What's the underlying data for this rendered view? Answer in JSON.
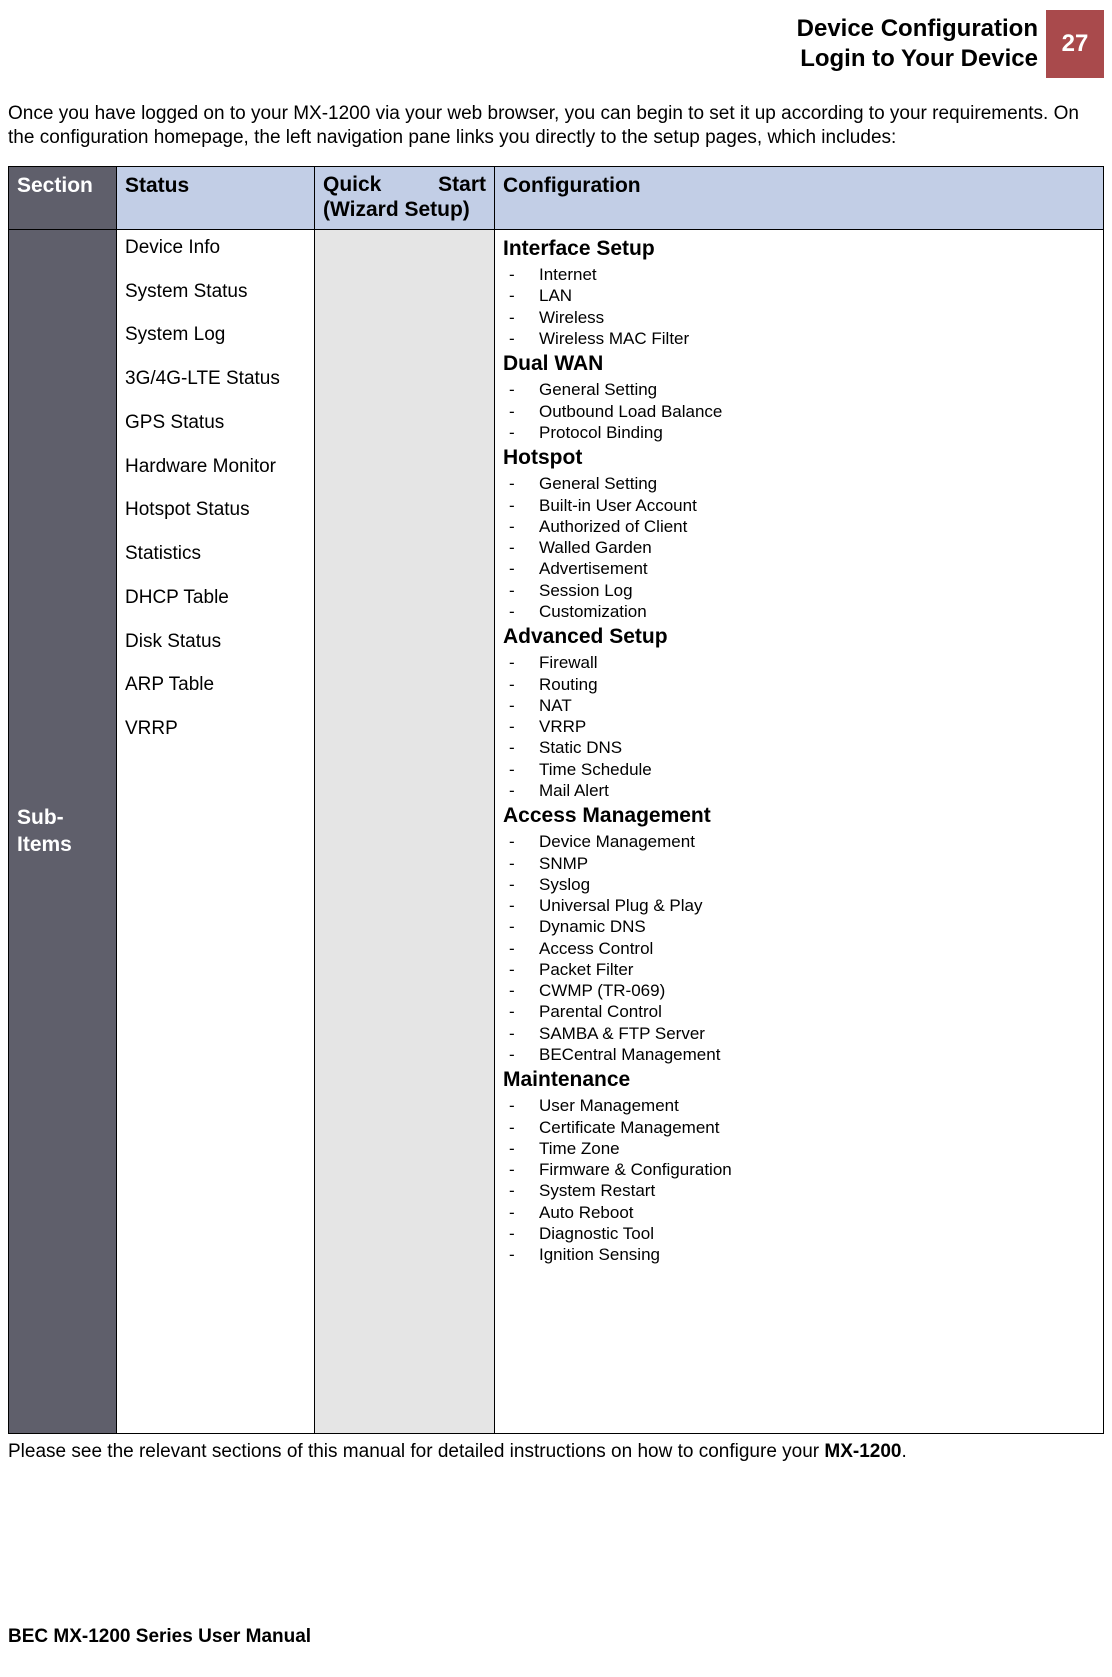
{
  "header": {
    "title_line1": "Device Configuration",
    "title_line2": "Login to Your Device",
    "page_number": "27"
  },
  "intro": "Once you have logged on to your MX-1200 via your web browser, you can begin to set it up according to your requirements. On the configuration homepage, the left navigation pane links you directly to the setup pages, which includes:",
  "table": {
    "headers": {
      "section": "Section",
      "status": "Status",
      "quick_start_left": "Quick",
      "quick_start_right": "Start",
      "quick_start_sub": "(Wizard Setup)",
      "configuration": "Configuration"
    },
    "row_label": "Sub-Items",
    "status_items": [
      "Device Info",
      "System Status",
      "System Log",
      "3G/4G-LTE Status",
      "GPS Status",
      "Hardware Monitor",
      "Hotspot Status",
      "Statistics",
      "DHCP Table",
      "Disk Status",
      "ARP Table",
      "VRRP"
    ],
    "configuration_groups": [
      {
        "heading": "Interface Setup",
        "items": [
          "Internet",
          "LAN",
          "Wireless",
          "Wireless MAC Filter"
        ]
      },
      {
        "heading": "Dual WAN",
        "items": [
          "General Setting",
          "Outbound Load Balance",
          "Protocol Binding"
        ]
      },
      {
        "heading": "Hotspot",
        "items": [
          "General Setting",
          "Built-in User Account",
          "Authorized of Client",
          "Walled Garden",
          "Advertisement",
          "Session Log",
          "Customization"
        ]
      },
      {
        "heading": "Advanced Setup",
        "items": [
          "Firewall",
          "Routing",
          "NAT",
          "VRRP",
          "Static DNS",
          "Time Schedule",
          "Mail Alert"
        ]
      },
      {
        "heading": "Access Management",
        "items": [
          "Device Management",
          "SNMP",
          "Syslog",
          "Universal Plug & Play",
          "Dynamic DNS",
          "Access Control",
          "Packet Filter",
          "CWMP (TR-069)",
          "Parental Control",
          "SAMBA & FTP Server",
          "BECentral Management"
        ]
      },
      {
        "heading": "Maintenance",
        "items": [
          "User Management",
          "Certificate Management",
          "Time Zone",
          "Firmware & Configuration",
          "System Restart",
          "Auto Reboot",
          "Diagnostic Tool",
          "Ignition Sensing"
        ]
      }
    ]
  },
  "outro_prefix": "Please see the relevant sections of this manual for detailed instructions on how to configure your ",
  "outro_bold": "MX-1200",
  "outro_suffix": ".",
  "footer": "BEC MX-1200 Series User Manual"
}
